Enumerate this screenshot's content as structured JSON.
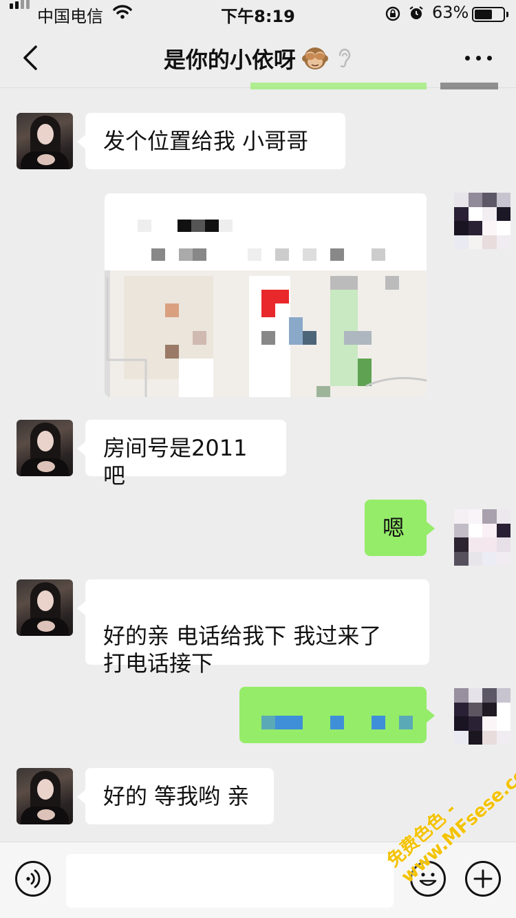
{
  "status_bar": {
    "carrier": "中国电信",
    "time": "下午8:19",
    "battery_percent": "63%",
    "battery_level": 0.63,
    "icons": [
      "signal-icon",
      "wifi-icon",
      "orientation-lock-icon",
      "alarm-icon",
      "battery-icon"
    ]
  },
  "nav": {
    "title": "是你的小依呀",
    "title_emoji": "see-no-evil-monkey-icon",
    "earpiece_icon": "ear-icon",
    "back_icon": "chevron-left-icon",
    "more_icon": "more-icon"
  },
  "messages": [
    {
      "sender": "contact",
      "type": "text",
      "text": "发个位置给我 小哥哥"
    },
    {
      "sender": "self",
      "type": "location",
      "note": "blurred"
    },
    {
      "sender": "contact",
      "type": "text",
      "text": "房间号是2011吧"
    },
    {
      "sender": "self",
      "type": "text",
      "text": "嗯"
    },
    {
      "sender": "contact",
      "type": "text",
      "text": "好的亲  电话给我下 我过来了\n打电话接下"
    },
    {
      "sender": "self",
      "type": "text",
      "text": "",
      "note": "blurred"
    },
    {
      "sender": "contact",
      "type": "text",
      "text": "好的 等我哟 亲"
    }
  ],
  "input_bar": {
    "voice_icon": "voice-icon",
    "emoji_icon": "emoji-icon",
    "plus_icon": "plus-icon",
    "placeholder": ""
  },
  "watermark": {
    "line1": "免费色色 -",
    "line2": "www.MFsese.com"
  },
  "colors": {
    "background": "#ededed",
    "incoming_bubble": "#ffffff",
    "outgoing_bubble": "#95ec69",
    "watermark": "#f3c200"
  }
}
